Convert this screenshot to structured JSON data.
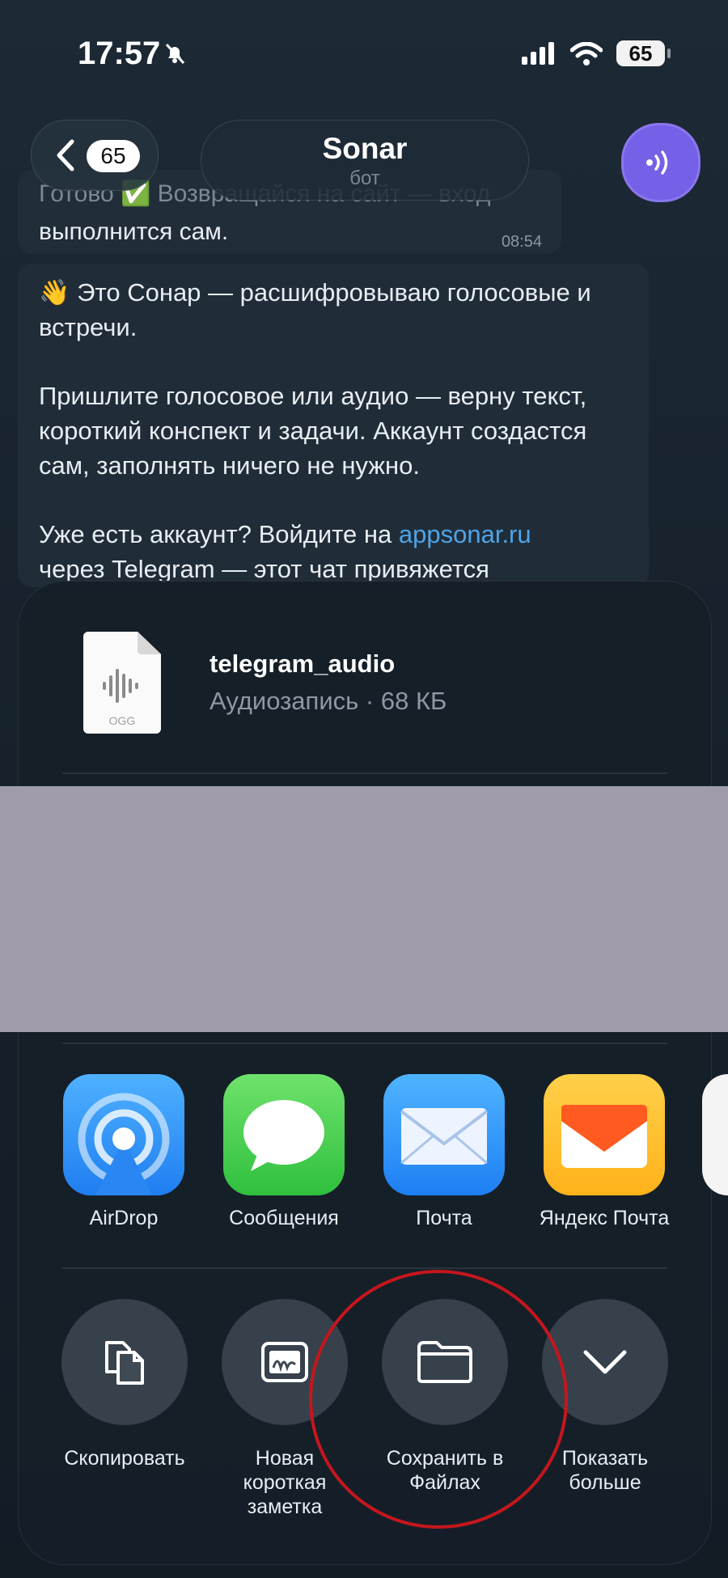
{
  "status_bar": {
    "time": "17:57",
    "battery": "65"
  },
  "nav": {
    "back_count": "65",
    "title": "Sonar",
    "subtitle": "бот"
  },
  "chat": {
    "msg1_partial": "Готово ✅ Возвращайся на сайт — вход",
    "msg1_text": "выполнится сам.",
    "msg1_time": "08:54",
    "msg2_p1": "👋 Это Сонар — расшифровываю голосовые и встречи.",
    "msg2_p2": "Пришлите голосовое или аудио — верну текст, короткий конспект и задачи. Аккаунт создастся сам, заполнять ничего не нужно.",
    "msg2_p3_prefix": "Уже есть аккаунт? Войдите на ",
    "msg2_link": "appsonar.ru",
    "msg2_p3_suffix": "через Telegram — этот чат привяжется"
  },
  "share_sheet": {
    "file": {
      "name": "telegram_audio",
      "meta": "Аудиозапись · 68 КБ",
      "ext": "OGG",
      "icon": "audio-file-icon"
    },
    "apps": [
      {
        "label": "AirDrop",
        "icon": "airdrop-icon"
      },
      {
        "label": "Сообщения",
        "icon": "messages-icon"
      },
      {
        "label": "Почта",
        "icon": "mail-icon"
      },
      {
        "label": "Яндекс Почта",
        "icon": "yandex-mail-icon"
      }
    ],
    "actions": [
      {
        "label": "Скопировать",
        "icon": "copy-icon"
      },
      {
        "label": "Новая короткая заметка",
        "icon": "quick-note-icon"
      },
      {
        "label": "Сохранить в Файлах",
        "icon": "folder-icon"
      },
      {
        "label": "Показать больше",
        "icon": "chevron-down-icon"
      }
    ]
  },
  "colors": {
    "accent_link": "#4fa3e6",
    "avatar": "#7560e8",
    "highlight_circle": "#c5161d",
    "redaction": "#a09cac"
  }
}
